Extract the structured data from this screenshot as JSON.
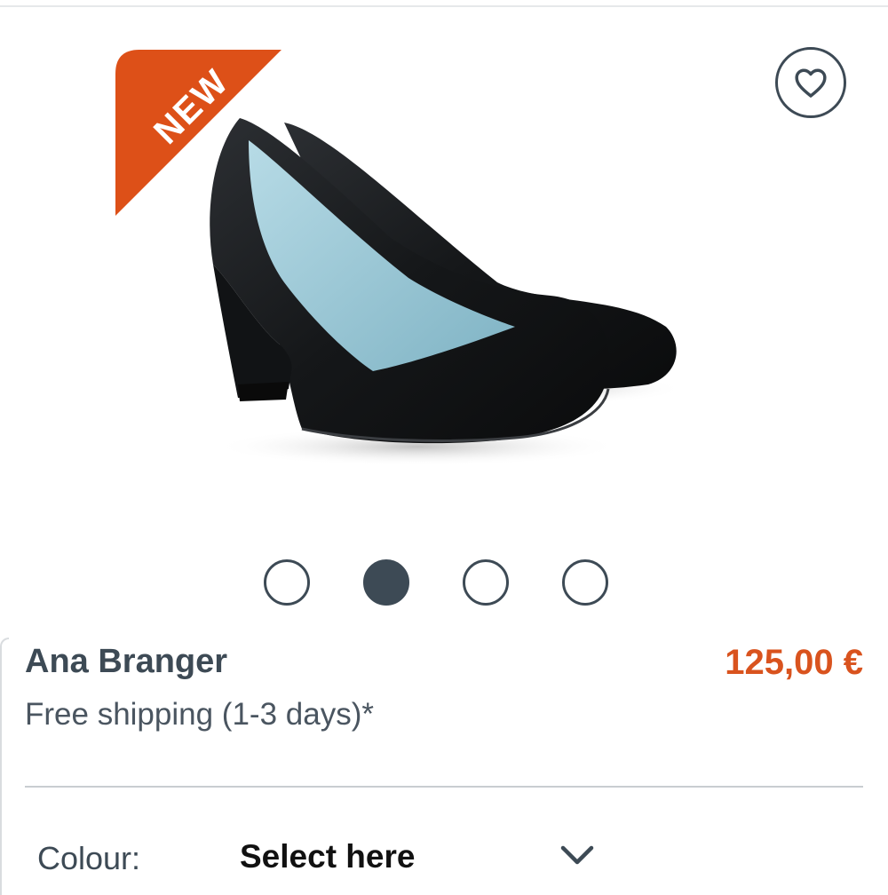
{
  "badge": {
    "label": "NEW",
    "color": "#dd5018"
  },
  "gallery": {
    "image_alt": "Black leather pump with block heel",
    "slides_count": 4,
    "active_slide": 2
  },
  "product": {
    "name": "Ana Branger",
    "price": "125,00 €",
    "price_color": "#d9531e",
    "shipping": "Free shipping (1-3 days)*"
  },
  "options": {
    "colour_label": "Colour:",
    "colour_value": "Select here"
  },
  "icons": {
    "wishlist": "heart-icon",
    "dropdown": "chevron-down-icon"
  }
}
